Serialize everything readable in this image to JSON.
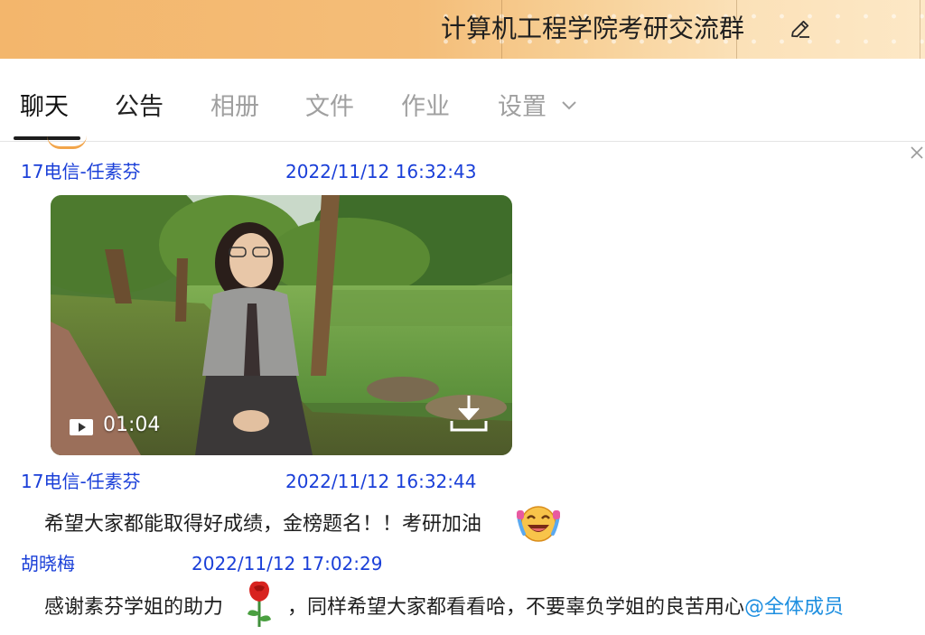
{
  "header": {
    "group_title": "计算机工程学院考研交流群"
  },
  "tabs": [
    {
      "label": "聊天"
    },
    {
      "label": "公告"
    },
    {
      "label": "相册"
    },
    {
      "label": "文件"
    },
    {
      "label": "作业"
    },
    {
      "label": "设置"
    }
  ],
  "messages": [
    {
      "sender": "17电信-任素芬",
      "time": "2022/11/12 16:32:43",
      "video": {
        "duration": "01:04"
      }
    },
    {
      "sender": "17电信-任素芬",
      "time": "2022/11/12 16:32:44",
      "text": "希望大家都能取得好成绩，金榜题名！！考研加油"
    },
    {
      "sender": "胡晓梅",
      "time": "2022/11/12 17:02:29",
      "text_before": "感谢素芬学姐的助力",
      "text_after": "，同样希望大家都看看哈，不要辜负学姐的良苦用心",
      "mention": "@全体成员"
    }
  ],
  "colors": {
    "sender": "#1a3fd8",
    "mention": "#1e8fe0",
    "header_start": "#f3b66c",
    "header_end": "#fde8c6"
  },
  "icons": [
    "edit-icon",
    "chevron-down-icon",
    "close-icon",
    "play-icon",
    "download-icon",
    "laughing-emoji-icon",
    "rose-emoji-icon"
  ]
}
